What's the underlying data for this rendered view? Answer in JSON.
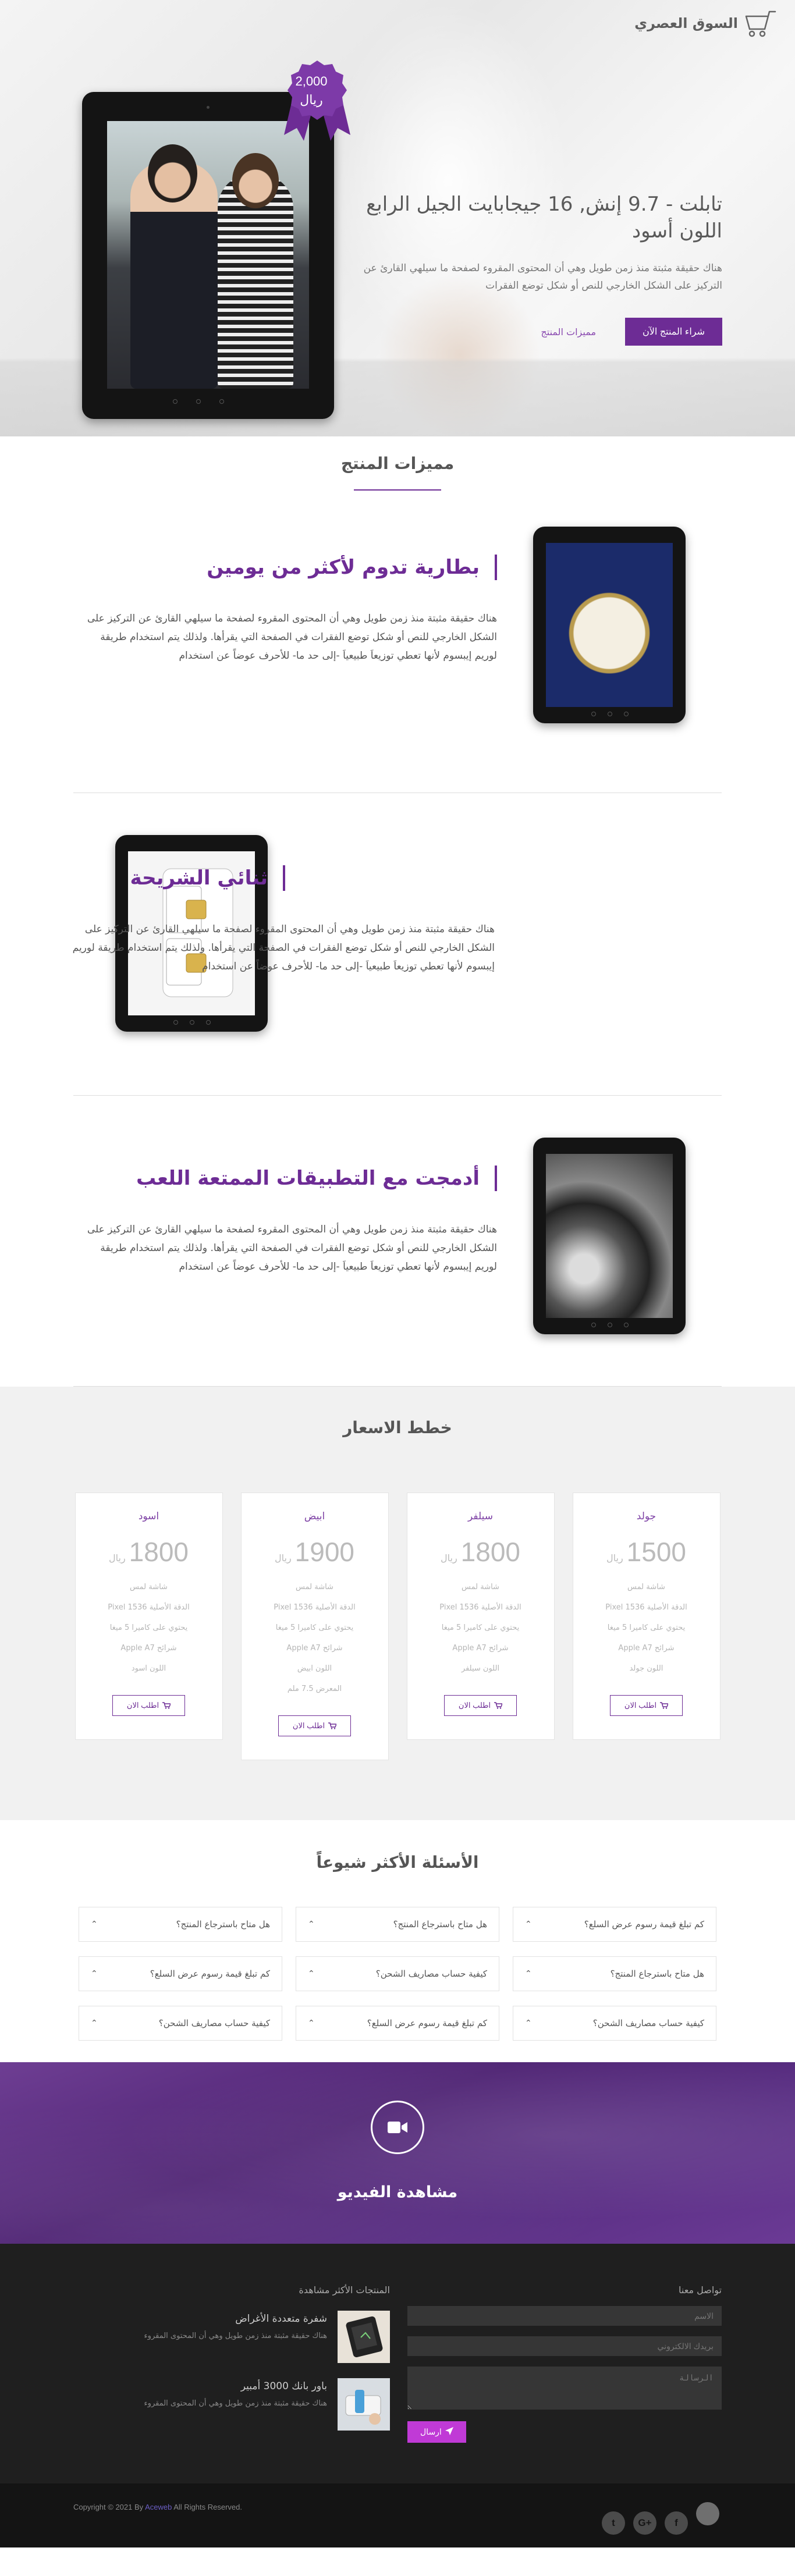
{
  "brand": {
    "name": "السوق العصري",
    "icon": "cart-icon"
  },
  "hero": {
    "badge_price": "2,000",
    "badge_currency": "ريال",
    "title": "تابلت - 9.7 إنش, 16 جيجابايت الجيل الرابع اللون أسود",
    "description": "هناك حقيقة مثبتة منذ زمن طويل وهي أن المحتوى المقروء لصفحة ما سيلهي القارئ عن التركيز على الشكل الخارجي للنص أو شكل توضع الفقرات",
    "buy_button": "شراء المنتج الآن",
    "features_link": "مميزات المنتج"
  },
  "features": {
    "title": "مميزات المنتج",
    "items": [
      {
        "title": "بطارية تدوم لأكثر من يومين",
        "description": "هناك حقيقة مثبتة منذ زمن طويل وهي أن المحتوى المقروء لصفحة ما سيلهي القارئ عن التركيز على الشكل الخارجي للنص أو شكل توضع الفقرات في الصفحة التي يقرأها. ولذلك يتم استخدام طريقة لوريم إيبسوم لأنها تعطي توزيعاَ طبيعياَ -إلى حد ما- للأحرف عوضاً عن استخدام"
      },
      {
        "title": "ثنائي الشريحة",
        "description": "هناك حقيقة مثبتة منذ زمن طويل وهي أن المحتوى المقروء لصفحة ما سيلهي القارئ عن التركيز على الشكل الخارجي للنص أو شكل توضع الفقرات في الصفحة التي يقرأها. ولذلك يتم استخدام طريقة لوريم إيبسوم لأنها تعطي توزيعاَ طبيعياَ -إلى حد ما- للأحرف عوضاً عن استخدام"
      },
      {
        "title": "أدمجت مع التطبيقات الممتعة اللعب",
        "description": "هناك حقيقة مثبتة منذ زمن طويل وهي أن المحتوى المقروء لصفحة ما سيلهي القارئ عن التركيز على الشكل الخارجي للنص أو شكل توضع الفقرات في الصفحة التي يقرأها. ولذلك يتم استخدام طريقة لوريم إيبسوم لأنها تعطي توزيعاَ طبيعياَ -إلى حد ما- للأحرف عوضاً عن استخدام"
      }
    ]
  },
  "pricing": {
    "title": "خطط الاسعار",
    "currency": "ريال",
    "order_label": "اطلب الان",
    "plans": [
      {
        "name": "جولد",
        "price": "1500",
        "features": [
          "شاشة لمس",
          "الدقة الأصلية Pixel 1536",
          "يحتوي على كاميرا 5 ميغا",
          "شرائح Apple A7",
          "اللون جولد"
        ]
      },
      {
        "name": "سيلفر",
        "price": "1800",
        "features": [
          "شاشة لمس",
          "الدقة الأصلية Pixel 1536",
          "يحتوي على كاميرا 5 ميغا",
          "شرائح Apple A7",
          "اللون سيلفر"
        ]
      },
      {
        "name": "ابيض",
        "price": "1900",
        "features": [
          "شاشة لمس",
          "الدقة الأصلية Pixel 1536",
          "يحتوي على كاميرا 5 ميغا",
          "شرائح Apple A7",
          "اللون ابيض",
          "المعرض 7.5 ملم"
        ]
      },
      {
        "name": "اسود",
        "price": "1800",
        "features": [
          "شاشة لمس",
          "الدقة الأصلية Pixel 1536",
          "يحتوي على كاميرا 5 ميغا",
          "شرائح Apple A7",
          "اللون اسود"
        ]
      }
    ]
  },
  "faq": {
    "title": "الأسئلة الأكثر شيوعاً",
    "items": [
      "كم تبلغ قيمة رسوم عرض السلع؟",
      "هل متاح باسترجاع المنتج؟",
      "هل متاح باسترجاع المنتج؟",
      "هل متاح باسترجاع المنتج؟",
      "كيفية حساب مصاريف الشحن؟",
      "كم تبلغ قيمة رسوم عرض السلع؟",
      "كيفية حساب مصاريف الشحن؟",
      "كم تبلغ قيمة رسوم عرض السلع؟",
      "كيفية حساب مصاريف الشحن؟"
    ]
  },
  "video": {
    "label": "مشاهدة الفيديو",
    "icon": "video-camera-icon"
  },
  "footer": {
    "contact_heading": "تواصل معنا",
    "name_placeholder": "الاسم",
    "email_placeholder": "بريدك الالكتروني",
    "message_placeholder": "الرسالة",
    "send_label": "ارسال",
    "products_heading": "المنتجات الأكثر مشاهدة",
    "products": [
      {
        "title": "شفرة متعددة الأغراض",
        "description": "هناك حقيقة مثبتة منذ زمن طويل وهي أن المحتوى المقروء"
      },
      {
        "title": "باور بانك 3000 أمبير",
        "description": "هناك حقيقة مثبتة منذ زمن طويل وهي أن المحتوى المقروء"
      }
    ],
    "copyright_prefix": "Copyright © 2021 By",
    "copyright_link": "Aceweb",
    "copyright_suffix": "All Rights Reserved.",
    "socials": [
      "twitter-icon",
      "google-plus-icon",
      "facebook-icon"
    ],
    "social_glyphs": [
      "t",
      "G+",
      "f"
    ]
  },
  "colors": {
    "accent": "#6d2c95",
    "send_button": "#c03ad6",
    "footer_bg": "#1f1f1f"
  }
}
